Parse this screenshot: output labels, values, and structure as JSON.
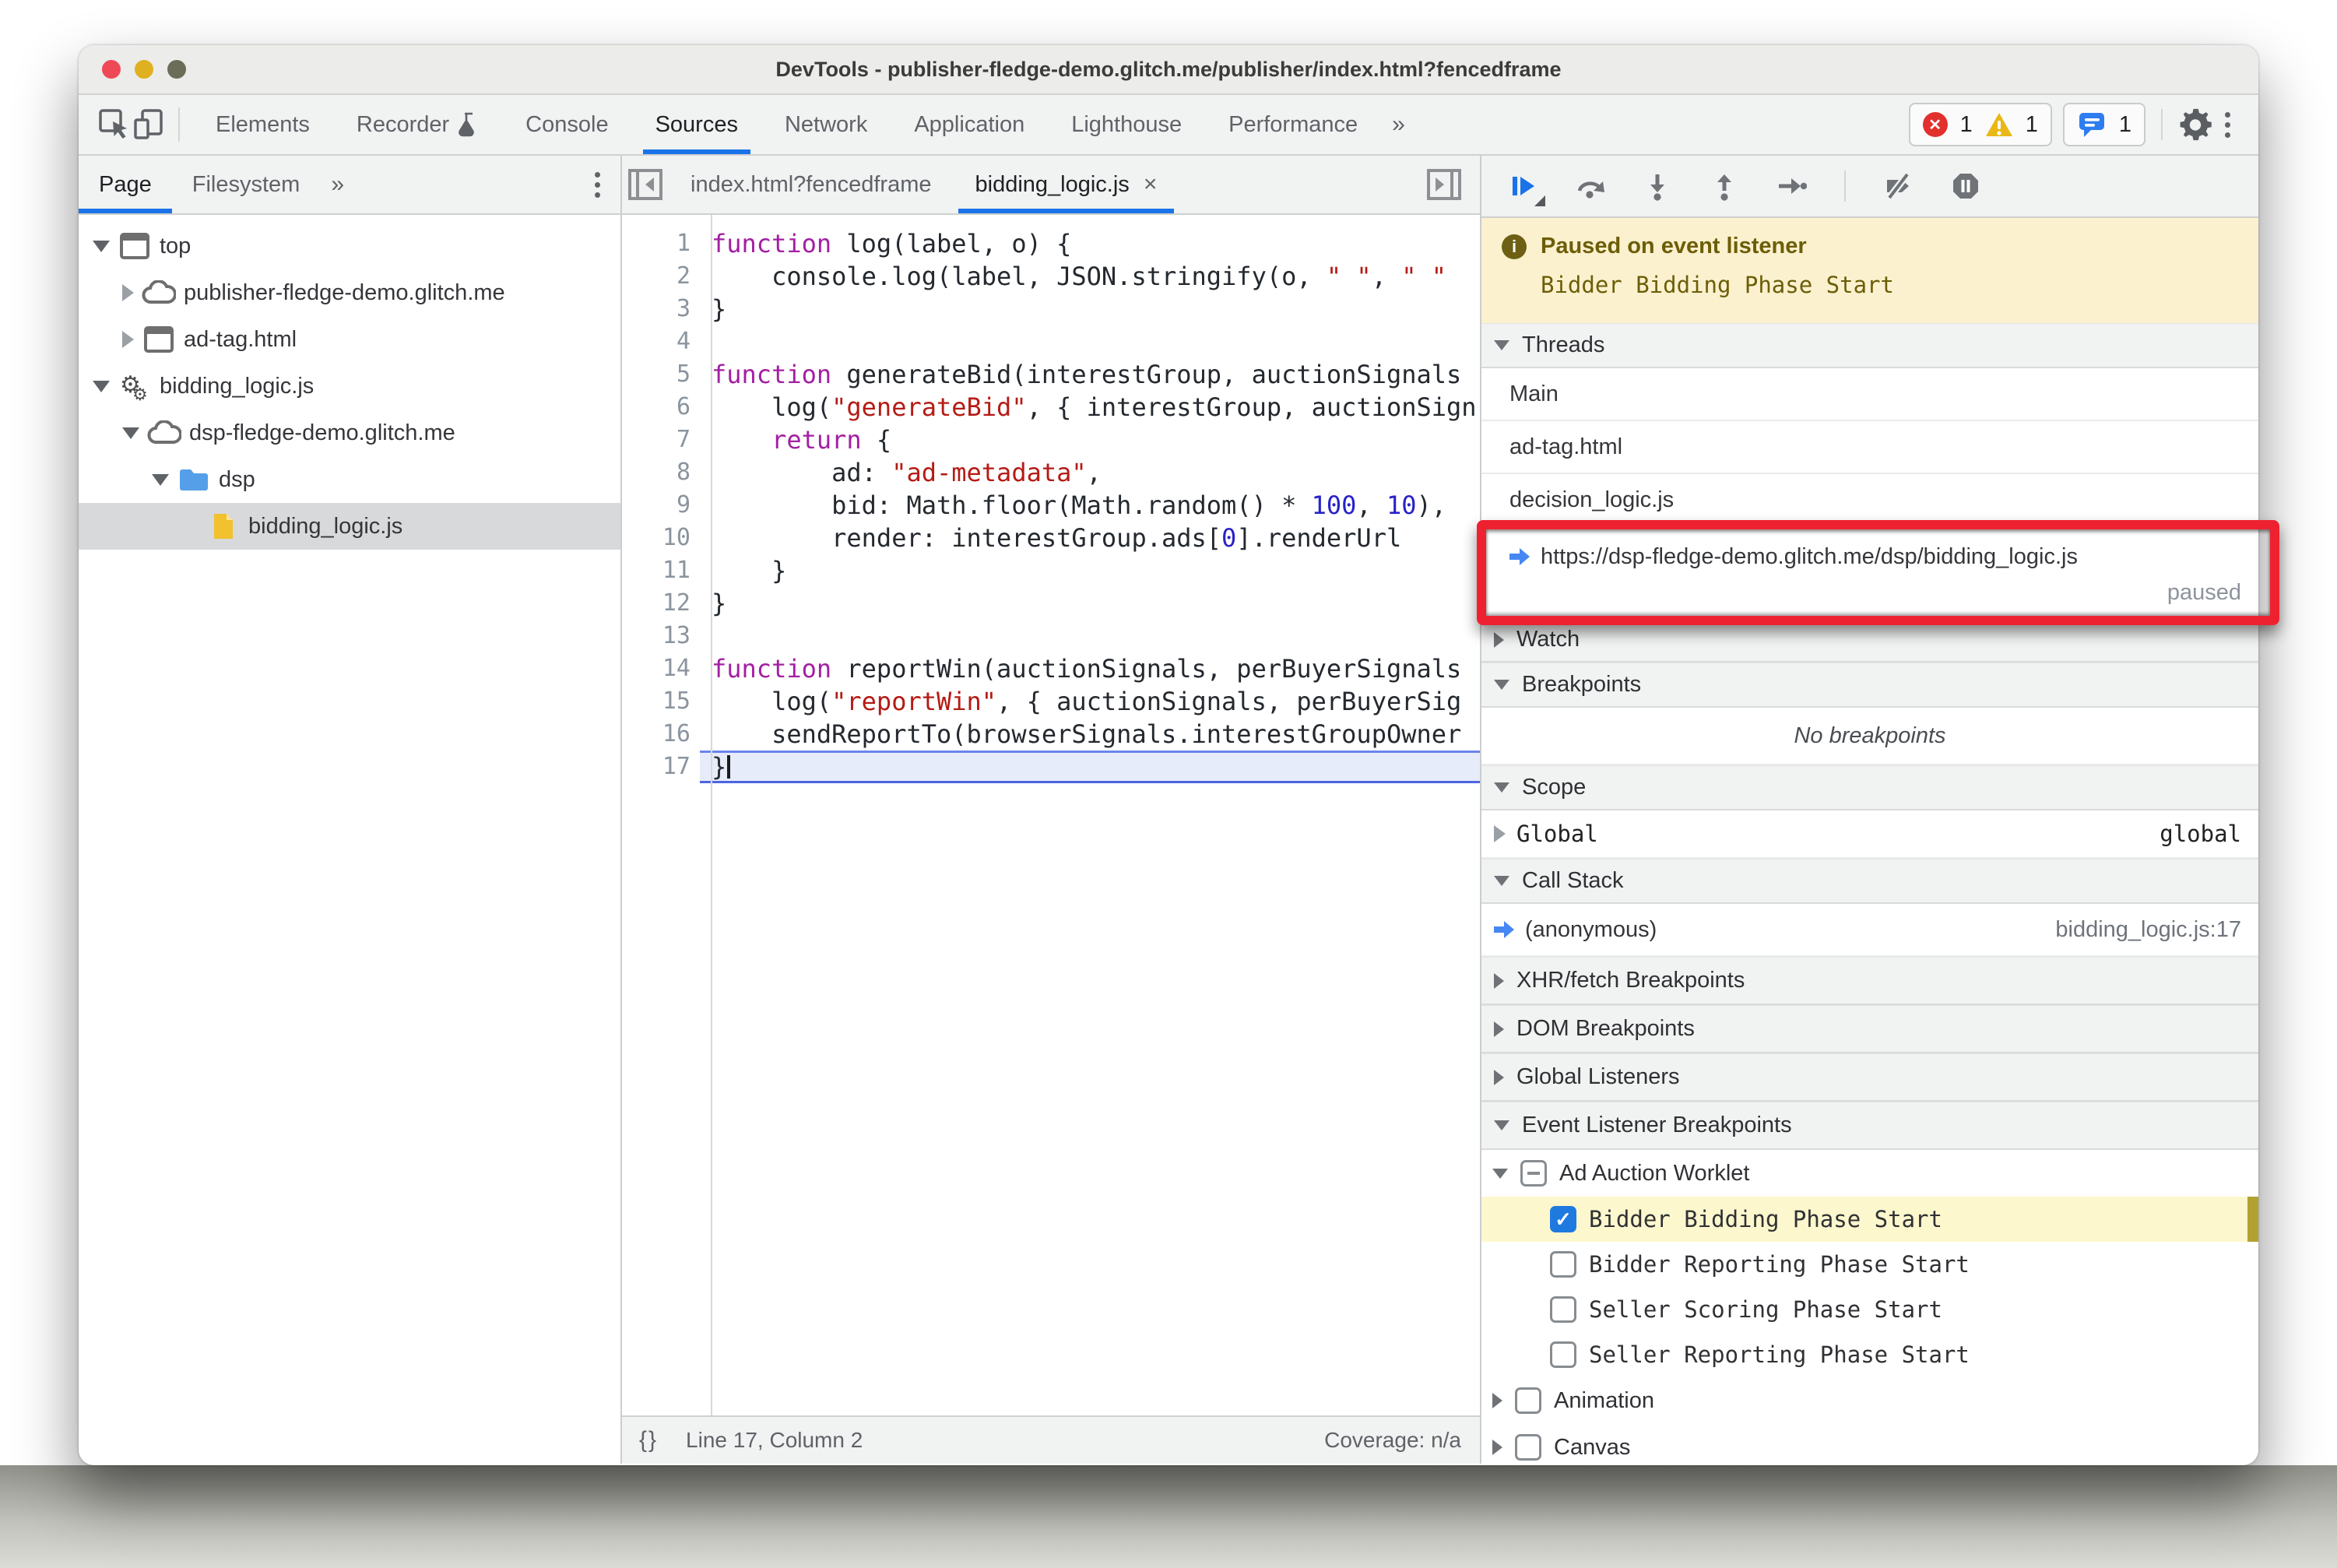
{
  "window": {
    "title": "DevTools - publisher-fledge-demo.glitch.me/publisher/index.html?fencedframe"
  },
  "toolbar": {
    "tabs": [
      "Elements",
      "Recorder",
      "Console",
      "Sources",
      "Network",
      "Application",
      "Lighthouse",
      "Performance"
    ],
    "active_tab": "Sources",
    "more_tabs": "»",
    "badges": {
      "errors": "1",
      "warnings": "1",
      "issues": "1"
    }
  },
  "sidebar": {
    "tabs": [
      "Page",
      "Filesystem"
    ],
    "active_tab": "Page",
    "more_tabs": "»",
    "tree": [
      {
        "icon": "frame",
        "label": "top",
        "arrow": "down",
        "depth": 0
      },
      {
        "icon": "cloud",
        "label": "publisher-fledge-demo.glitch.me",
        "arrow": "right",
        "depth": 1
      },
      {
        "icon": "frame",
        "label": "ad-tag.html",
        "arrow": "right",
        "depth": 1
      },
      {
        "icon": "gears",
        "label": "bidding_logic.js",
        "arrow": "down",
        "depth": 0
      },
      {
        "icon": "cloud",
        "label": "dsp-fledge-demo.glitch.me",
        "arrow": "down",
        "depth": 1
      },
      {
        "icon": "folder",
        "label": "dsp",
        "arrow": "down",
        "depth": 2
      },
      {
        "icon": "file",
        "label": "bidding_logic.js",
        "arrow": "none",
        "depth": 3,
        "selected": true
      }
    ]
  },
  "editor": {
    "tabs": [
      {
        "label": "index.html?fencedframe",
        "active": false
      },
      {
        "label": "bidding_logic.js",
        "active": true,
        "close": "×"
      }
    ],
    "current_line": 17,
    "lines": [
      {
        "n": 1,
        "tokens": [
          [
            "k",
            "function"
          ],
          [
            "t",
            " log(label, o) {"
          ]
        ]
      },
      {
        "n": 2,
        "tokens": [
          [
            "t",
            "    console.log(label, JSON.stringify(o, "
          ],
          [
            "s",
            "\" \""
          ],
          [
            "t",
            ", "
          ],
          [
            "s",
            "\" \""
          ]
        ]
      },
      {
        "n": 3,
        "tokens": [
          [
            "t",
            "}"
          ]
        ]
      },
      {
        "n": 4,
        "tokens": []
      },
      {
        "n": 5,
        "tokens": [
          [
            "k",
            "function"
          ],
          [
            "t",
            " generateBid(interestGroup, auctionSignals"
          ]
        ]
      },
      {
        "n": 6,
        "tokens": [
          [
            "t",
            "    log("
          ],
          [
            "s",
            "\"generateBid\""
          ],
          [
            "t",
            ", { interestGroup, auctionSign"
          ]
        ]
      },
      {
        "n": 7,
        "tokens": [
          [
            "t",
            "    "
          ],
          [
            "k",
            "return"
          ],
          [
            "t",
            " {"
          ]
        ]
      },
      {
        "n": 8,
        "tokens": [
          [
            "t",
            "        ad: "
          ],
          [
            "s",
            "\"ad-metadata\""
          ],
          [
            "t",
            ","
          ]
        ]
      },
      {
        "n": 9,
        "tokens": [
          [
            "t",
            "        bid: Math.floor(Math.random() * "
          ],
          [
            "n",
            "100"
          ],
          [
            "t",
            ", "
          ],
          [
            "n",
            "10"
          ],
          [
            "t",
            "),"
          ]
        ]
      },
      {
        "n": 10,
        "tokens": [
          [
            "t",
            "        render: interestGroup.ads["
          ],
          [
            "n",
            "0"
          ],
          [
            "t",
            "].renderUrl"
          ]
        ]
      },
      {
        "n": 11,
        "tokens": [
          [
            "t",
            "    }"
          ]
        ]
      },
      {
        "n": 12,
        "tokens": [
          [
            "t",
            "}"
          ]
        ]
      },
      {
        "n": 13,
        "tokens": []
      },
      {
        "n": 14,
        "tokens": [
          [
            "k",
            "function"
          ],
          [
            "t",
            " reportWin(auctionSignals, perBuyerSignals"
          ]
        ]
      },
      {
        "n": 15,
        "tokens": [
          [
            "t",
            "    log("
          ],
          [
            "s",
            "\"reportWin\""
          ],
          [
            "t",
            ", { auctionSignals, perBuyerSig"
          ]
        ]
      },
      {
        "n": 16,
        "tokens": [
          [
            "t",
            "    sendReportTo(browserSignals.interestGroupOwner"
          ]
        ]
      },
      {
        "n": 17,
        "tokens": [
          [
            "t",
            "}"
          ]
        ]
      }
    ],
    "status": {
      "braces": "{}",
      "position": "Line 17, Column 2",
      "coverage": "Coverage: n/a"
    }
  },
  "debugger": {
    "paused_banner": {
      "title": "Paused on event listener",
      "subtitle": "Bidder Bidding Phase Start"
    },
    "threads": {
      "title": "Threads",
      "items": [
        {
          "label": "Main"
        },
        {
          "label": "ad-tag.html"
        },
        {
          "label": "decision_logic.js"
        },
        {
          "label": "https://dsp-fledge-demo.glitch.me/dsp/bidding_logic.js",
          "status": "paused",
          "active": true,
          "annotated": true
        }
      ]
    },
    "watch": {
      "title": "Watch"
    },
    "breakpoints": {
      "title": "Breakpoints",
      "empty": "No breakpoints"
    },
    "scope": {
      "title": "Scope",
      "rows": [
        {
          "label": "Global",
          "value": "global"
        }
      ]
    },
    "call_stack": {
      "title": "Call Stack",
      "rows": [
        {
          "label": "(anonymous)",
          "location": "bidding_logic.js:17"
        }
      ]
    },
    "xhr_breakpoints": {
      "title": "XHR/fetch Breakpoints"
    },
    "dom_breakpoints": {
      "title": "DOM Breakpoints"
    },
    "global_listeners": {
      "title": "Global Listeners"
    },
    "event_listener_breakpoints": {
      "title": "Event Listener Breakpoints",
      "category": {
        "label": "Ad Auction Worklet",
        "checkbox": "indeterminate",
        "expanded": true
      },
      "items": [
        {
          "label": "Bidder Bidding Phase Start",
          "checked": true,
          "highlighted": true
        },
        {
          "label": "Bidder Reporting Phase Start",
          "checked": false
        },
        {
          "label": "Seller Scoring Phase Start",
          "checked": false
        },
        {
          "label": "Seller Reporting Phase Start",
          "checked": false
        }
      ],
      "more_categories": [
        {
          "label": "Animation",
          "checked": false
        },
        {
          "label": "Canvas",
          "checked": false
        }
      ]
    }
  },
  "colors": {
    "accent_blue": "#1a73e8",
    "annotation_red": "#ee2130",
    "paused_banner_bg": "#fbf1ce",
    "paused_banner_text": "#6c5e08",
    "highlight_row_bg": "#fcf7cd",
    "selected_row_bg": "#d8d9da",
    "error_red": "#e2302e",
    "warning_yellow": "#e9b816"
  }
}
